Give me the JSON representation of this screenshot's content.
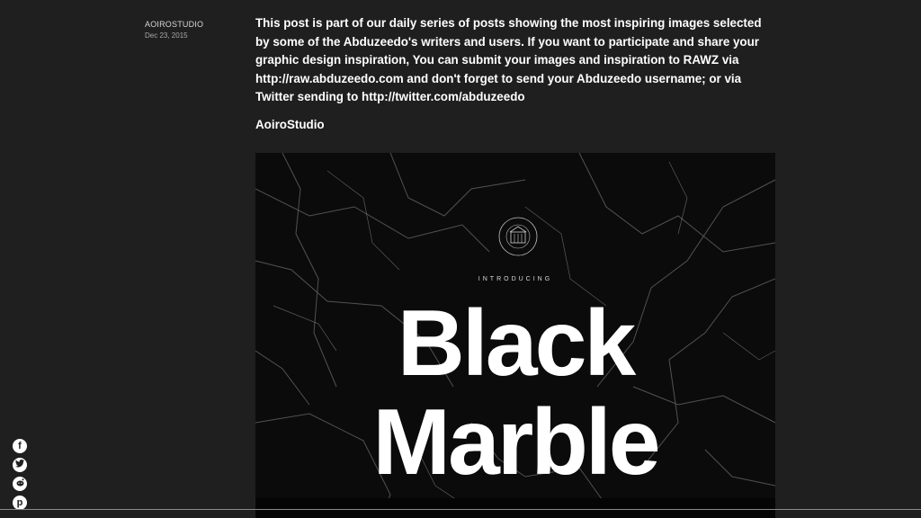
{
  "post": {
    "author": "AOIROSTUDIO",
    "date": "Dec 23, 2015",
    "intro": "This post is part of our daily series of posts showing the most inspiring images selected by some of the Abduzeedo's writers and users. If you want to participate and share your graphic design inspiration, You can submit your images and inspiration to RAWZ via http://raw.abduzeedo.com and don't forget to send your Abduzeedo username; or via Twitter sending to http://twitter.com/abduzeedo",
    "signature": "AoiroStudio"
  },
  "hero": {
    "introducing": "INTRODUCING",
    "title_line1": "Black",
    "title_line2": "Marble",
    "emblem_text_top": "HOUSE OF ARTISTS",
    "emblem_text_bottom": "NEW YORK CITY"
  },
  "share": {
    "items": [
      {
        "icon": "facebook-icon",
        "glyph": "f"
      },
      {
        "icon": "twitter-icon",
        "glyph": "t"
      },
      {
        "icon": "reddit-icon",
        "glyph": "r"
      },
      {
        "icon": "pinterest-icon",
        "glyph": "p"
      }
    ]
  },
  "colors": {
    "background": "#1f1f1f",
    "text": "#ffffff",
    "hero_background": "#0b0b0b"
  }
}
